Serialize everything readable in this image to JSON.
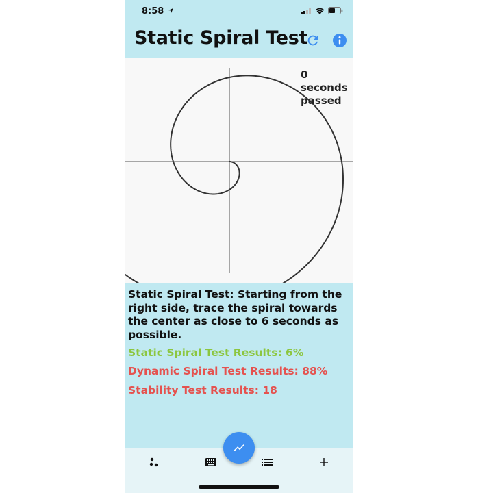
{
  "status_bar": {
    "time": "8:58"
  },
  "app_bar": {
    "title": "Static Spiral Test",
    "refresh_icon": "refresh-icon",
    "info_icon": "info-icon"
  },
  "canvas": {
    "timer_value": "0",
    "timer_unit": "seconds",
    "timer_suffix": "passed"
  },
  "instructions": "Static Spiral Test: Starting from the right side, trace the spiral towards the center as close to 6 seconds as possible.",
  "results": {
    "static": "Static Spiral Test Results: 6%",
    "dynamic": "Dynamic Spiral Test Results: 88%",
    "stability": "Stability Test Results: 18"
  },
  "colors": {
    "background": "#c0e9f1",
    "static_result": "#8cc63f",
    "other_results": "#e5524f",
    "accent": "#3d8ef0"
  },
  "bottom_nav": {
    "items": [
      "dots-icon",
      "keyboard-icon",
      "list-icon",
      "plus-icon"
    ],
    "fab_icon": "trend-chart-icon"
  }
}
